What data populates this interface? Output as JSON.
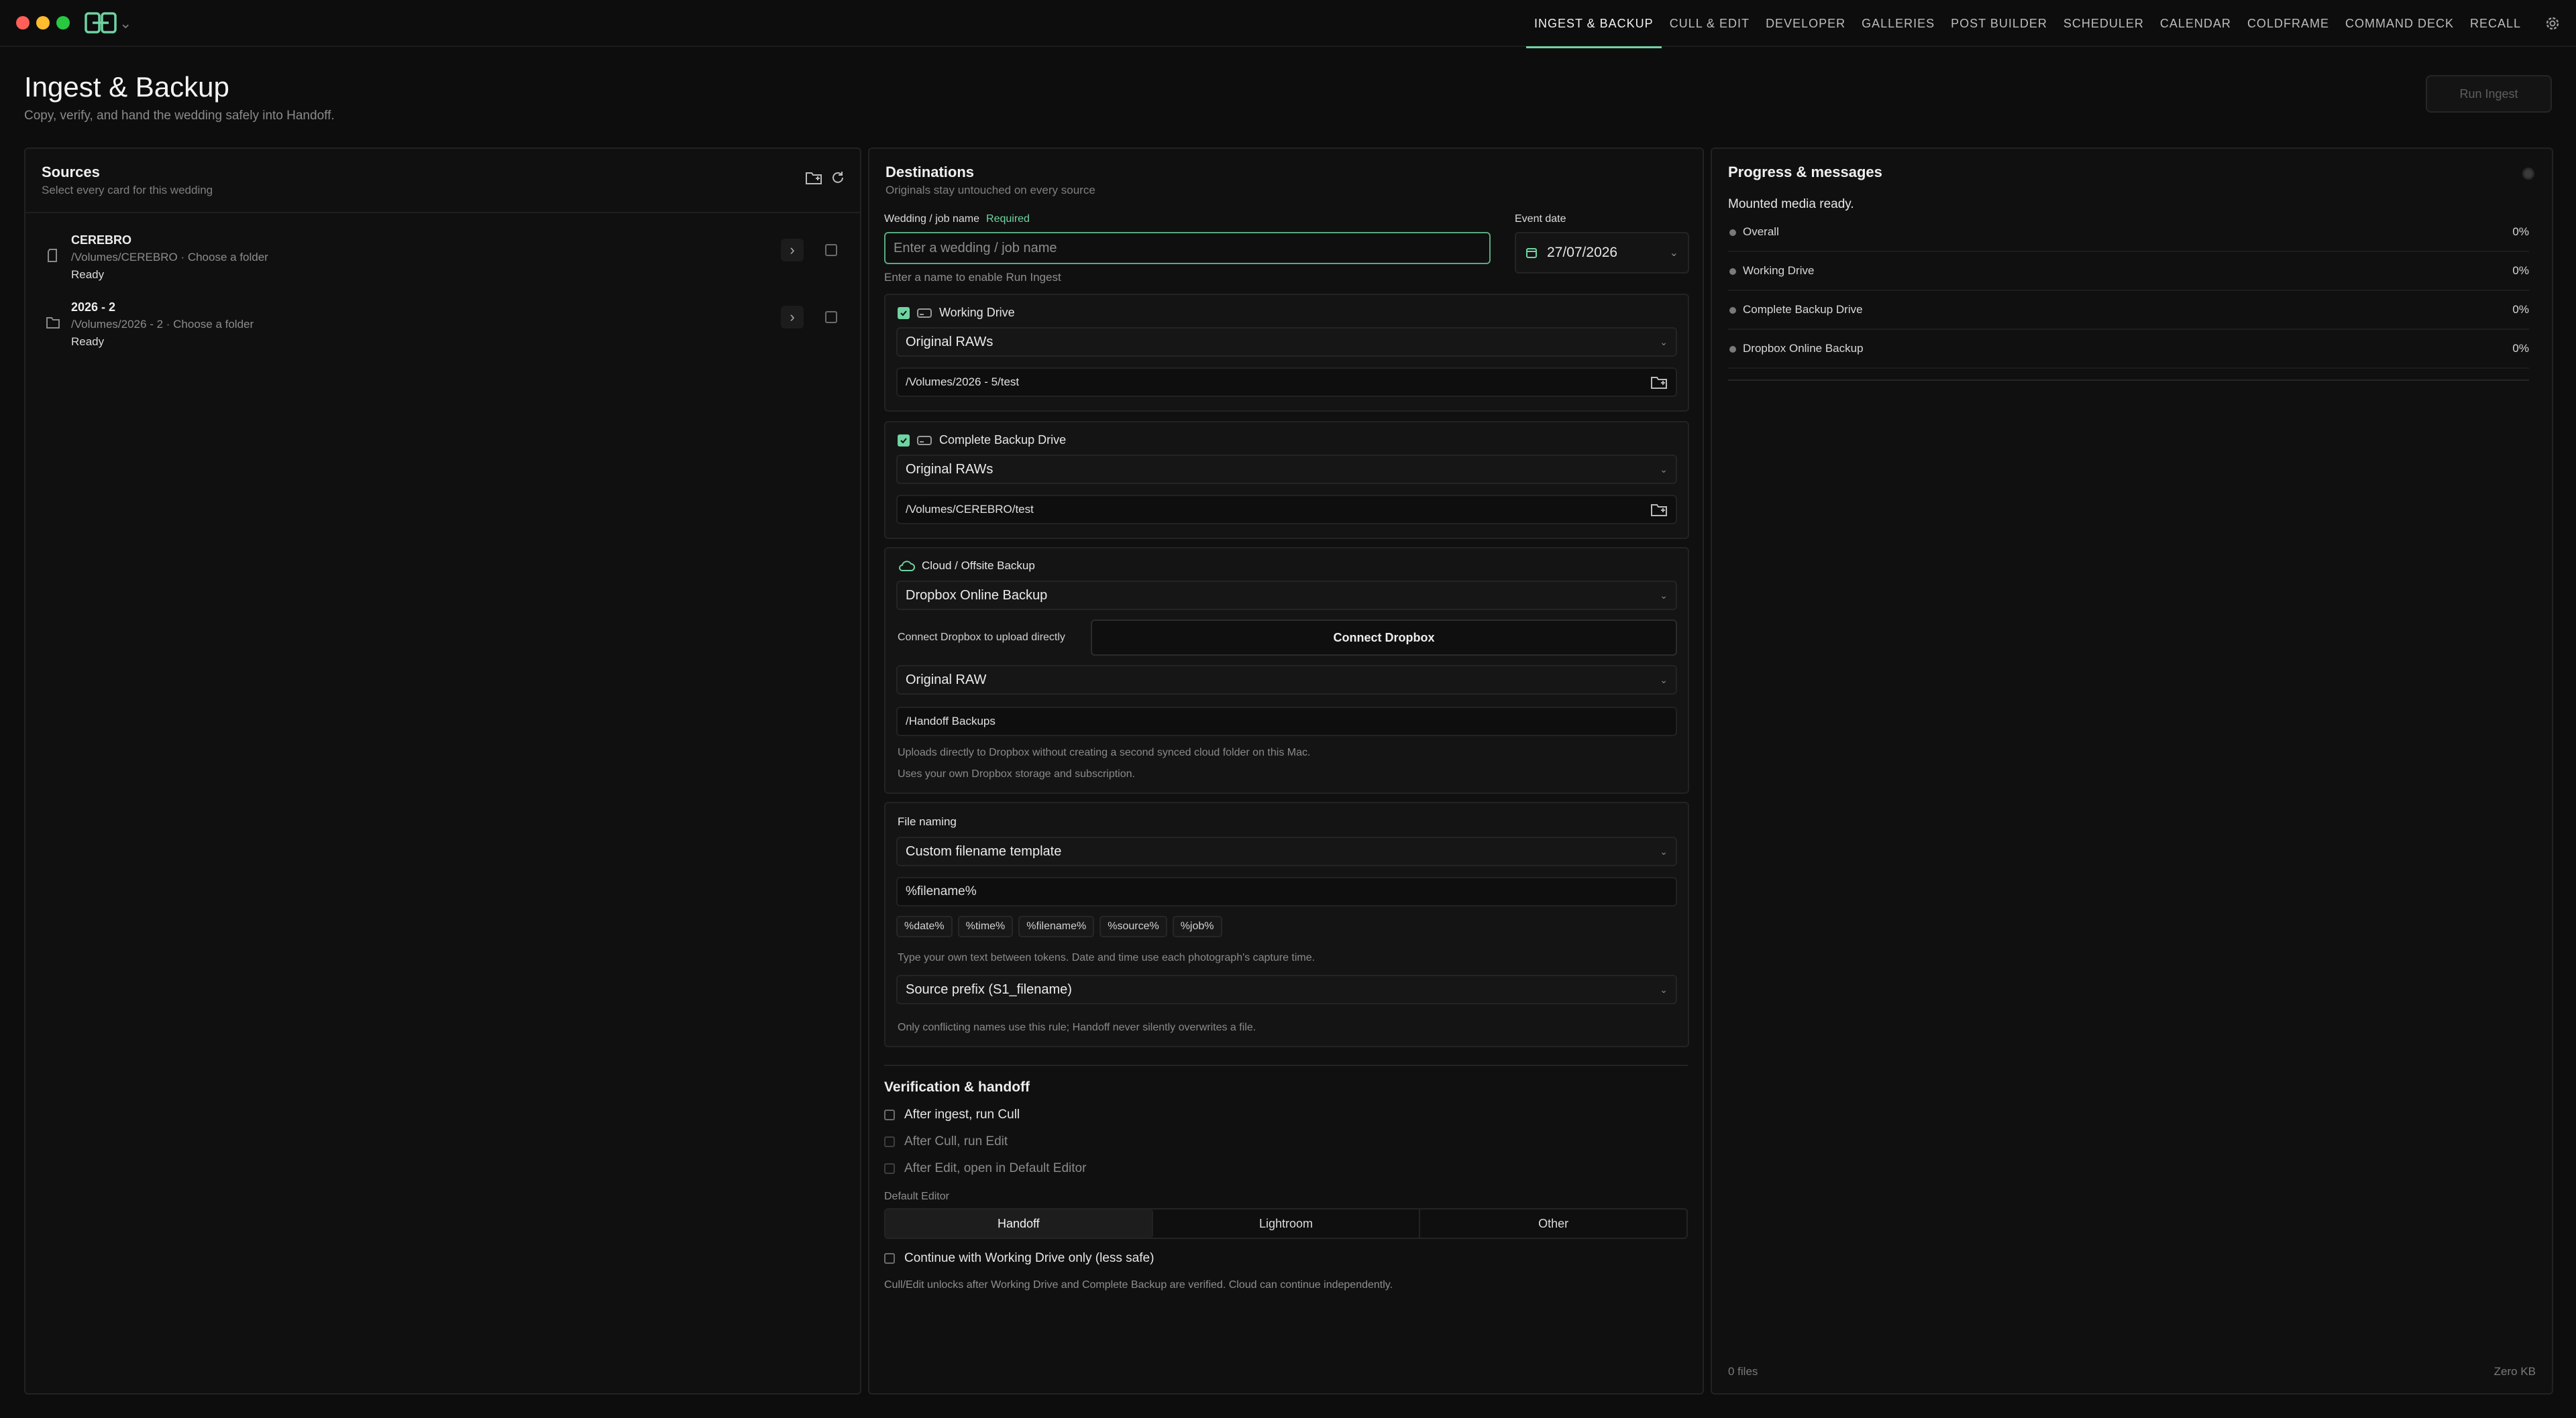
{
  "app": {
    "nav": [
      "INGEST & BACKUP",
      "CULL & EDIT",
      "DEVELOPER",
      "GALLERIES",
      "POST BUILDER",
      "SCHEDULER",
      "CALENDAR",
      "COLDFRAME",
      "COMMAND DECK",
      "RECALL"
    ],
    "active_nav": "INGEST & BACKUP"
  },
  "page": {
    "title": "Ingest & Backup",
    "subtitle": "Copy, verify, and hand the wedding safely into Handoff.",
    "run_button": "Run Ingest"
  },
  "sources": {
    "title": "Sources",
    "subtitle": "Select every card for this wedding",
    "items": [
      {
        "name": "CEREBRO",
        "path": "/Volumes/CEREBRO · Choose a folder",
        "status": "Ready",
        "icon": "sd-card-icon"
      },
      {
        "name": "2026 - 2",
        "path": "/Volumes/2026 - 2 · Choose a folder",
        "status": "Ready",
        "icon": "folder-icon"
      }
    ]
  },
  "destinations": {
    "title": "Destinations",
    "subtitle": "Originals stay untouched on every source",
    "job_label": "Wedding / job name",
    "job_required": "Required",
    "job_placeholder": "Enter a wedding / job name",
    "job_hint": "Enter a name to enable Run Ingest",
    "date_label": "Event date",
    "date_value": "27/07/2026",
    "working": {
      "label": "Working Drive",
      "folder": "Original RAWs",
      "path": "/Volumes/2026 - 5/test",
      "checked": true
    },
    "backup": {
      "label": "Complete Backup Drive",
      "folder": "Original RAWs",
      "path": "/Volumes/CEREBRO/test",
      "checked": true
    },
    "cloud": {
      "label": "Cloud / Offsite Backup",
      "provider": "Dropbox Online Backup",
      "connect_text": "Connect Dropbox to upload directly",
      "connect_button": "Connect Dropbox",
      "content": "Original RAW",
      "path": "/Handoff Backups",
      "note1": "Uploads directly to Dropbox without creating a second synced cloud folder on this Mac.",
      "note2": "Uses your own Dropbox storage and subscription."
    },
    "naming": {
      "label": "File naming",
      "template": "Custom filename template",
      "pattern": "%filename%",
      "tokens": [
        "%date%",
        "%time%",
        "%filename%",
        "%source%",
        "%job%"
      ],
      "token_hint": "Type your own text between tokens. Date and time use each photograph's capture time.",
      "conflict": "Source prefix (S1_filename)",
      "conflict_hint": "Only conflicting names use this rule; Handoff never silently overwrites a file."
    },
    "verification": {
      "title": "Verification & handoff",
      "opt1": "After ingest, run Cull",
      "opt2": "After Cull, run Edit",
      "opt3": "After Edit, open in Default Editor",
      "editor_label": "Default Editor",
      "editors": [
        "Handoff",
        "Lightroom",
        "Other"
      ],
      "active_editor": "Handoff",
      "continue": "Continue with Working Drive only (less safe)",
      "footnote": "Cull/Edit unlocks after Working Drive and Complete Backup are verified. Cloud can continue independently."
    }
  },
  "progress": {
    "title": "Progress & messages",
    "message": "Mounted media ready.",
    "rows": [
      {
        "label": "Overall",
        "value": "0%",
        "fraction": 0
      },
      {
        "label": "Working Drive",
        "value": "0%",
        "fraction": 0
      },
      {
        "label": "Complete Backup Drive",
        "value": "0%",
        "fraction": 0
      },
      {
        "label": "Dropbox Online Backup",
        "value": "0%",
        "fraction": 0
      }
    ],
    "files": "0 files",
    "size": "Zero KB"
  },
  "colors": {
    "accent": "#6fd4a2",
    "background": "#0d0d0d",
    "panel": "#101010"
  }
}
